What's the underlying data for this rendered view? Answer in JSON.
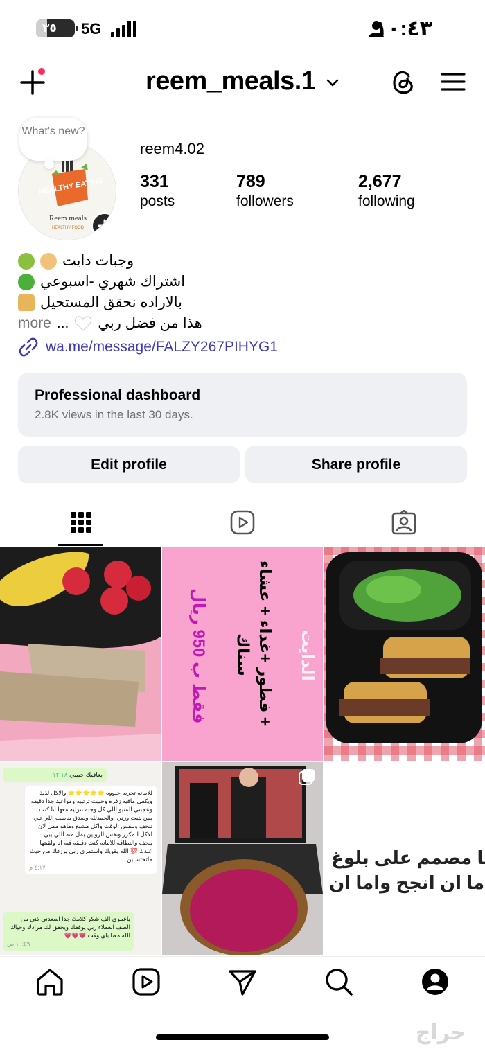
{
  "status_bar": {
    "battery": "٣٥",
    "network": "5G",
    "time": "١٠:٤٣",
    "icons": [
      "battery-icon",
      "signal-icon",
      "person-icon"
    ]
  },
  "header": {
    "username": "reem_meals.1",
    "icons": [
      "create-plus-icon",
      "chevron-down-icon",
      "threads-icon",
      "menu-icon"
    ],
    "notification_dot_color": "#ff2d55"
  },
  "profile": {
    "note_placeholder": "What's new?",
    "avatar_text": {
      "badge": "HEALTHY EATING",
      "brand": "Reem meals",
      "tagline": "HEALTHY FOOD"
    },
    "threads_handle": "reem4.02",
    "stats": [
      {
        "count": "331",
        "label": "posts"
      },
      {
        "count": "789",
        "label": "followers"
      },
      {
        "count": "2,677",
        "label": "following"
      }
    ],
    "bio": [
      "وجبات دايت",
      "اشتراك شهري -اسبوعي",
      "بالاراده نحقق المستحيل",
      "هذا من فضل ربي"
    ],
    "bio_more": "more",
    "bio_ellipsis": "...",
    "link": "wa.me/message/FALZY267PIHYG1"
  },
  "dashboard": {
    "title": "Professional dashboard",
    "subtitle": "2.8K views in the last 30 days."
  },
  "actions": {
    "edit": "Edit profile",
    "share": "Share profile"
  },
  "tabs": [
    {
      "icon": "grid-icon",
      "active": true
    },
    {
      "icon": "reels-icon",
      "active": false
    },
    {
      "icon": "tagged-icon",
      "active": false
    }
  ],
  "posts": {
    "post2": {
      "line1": "الدايت",
      "line2": "فطور +غداء + عشاء +",
      "line3": "سناك",
      "line4": "فقط ب 950 ريال"
    },
    "post4": {
      "header": "يعافيك حبيبي",
      "header_time": "١٢:١٨",
      "msg1": "للامانه تجربه حلووه ⭐⭐⭐⭐⭐ والاكل لذيذ ويكفي مافيه زفره وحبيت ترتيبه ومواعيد جدا دقيقه وعجبني المنيو اللي كل وجبه تنزليه معها انا كنت بس بثبت وزني, والحمدلله وصدق يناسب اللي تبي تنحف وبنفس الوقت واكل مشبع وماهو ممل لان الاكل المكرر ونفس الروتين يمل منه اللي يبي ينحف والنظافه للامانه كنت دقيقه فيه انا ولقيتها عندك 💯 الله يقويك واستمري ربي يرزقك من حيث ماتحتسبين",
      "msg1_time": "٤:١٧ م",
      "msg2": "ياعمري الف شكر كلامك جدا اسعدني كني من الطف العملاء ربي يوفقك ويحقق لك مرادك وحياك الله معنا باي وقت 💗💗💗",
      "msg2_time": "١٠:٥٩ ص"
    },
    "post6": {
      "line1": "نا مصمم على بلوغ",
      "line2": "اما ان انجح واما ان"
    }
  },
  "bottom_nav": [
    "home-icon",
    "reels-icon",
    "direct-message-icon",
    "search-icon",
    "profile-icon"
  ],
  "watermark": "حراج"
}
